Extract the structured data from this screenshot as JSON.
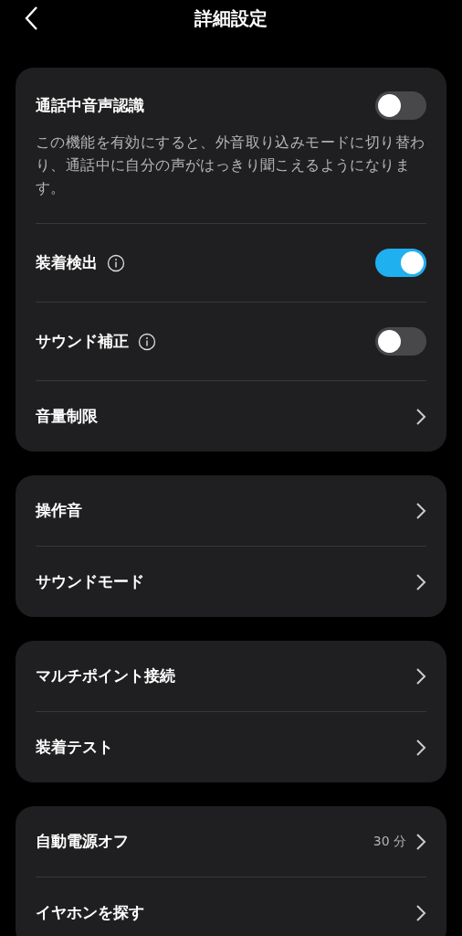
{
  "header": {
    "title": "詳細設定"
  },
  "sections": [
    {
      "items": [
        {
          "kind": "toggle",
          "label": "通話中音声認識",
          "on": false,
          "description": "この機能を有効にすると、外音取り込みモードに切り替わり、通話中に自分の声がはっきり聞こえるようになります。"
        },
        {
          "kind": "toggle",
          "label": "装着検出",
          "info": true,
          "on": true
        },
        {
          "kind": "toggle",
          "label": "サウンド補正",
          "info": true,
          "on": false
        },
        {
          "kind": "link",
          "label": "音量制限"
        }
      ]
    },
    {
      "items": [
        {
          "kind": "link",
          "label": "操作音"
        },
        {
          "kind": "link",
          "label": "サウンドモード"
        }
      ]
    },
    {
      "items": [
        {
          "kind": "link",
          "label": "マルチポイント接続"
        },
        {
          "kind": "link",
          "label": "装着テスト"
        }
      ]
    },
    {
      "items": [
        {
          "kind": "link",
          "label": "自動電源オフ",
          "value": "30 分"
        },
        {
          "kind": "link",
          "label": "イヤホンを探す"
        }
      ]
    }
  ]
}
